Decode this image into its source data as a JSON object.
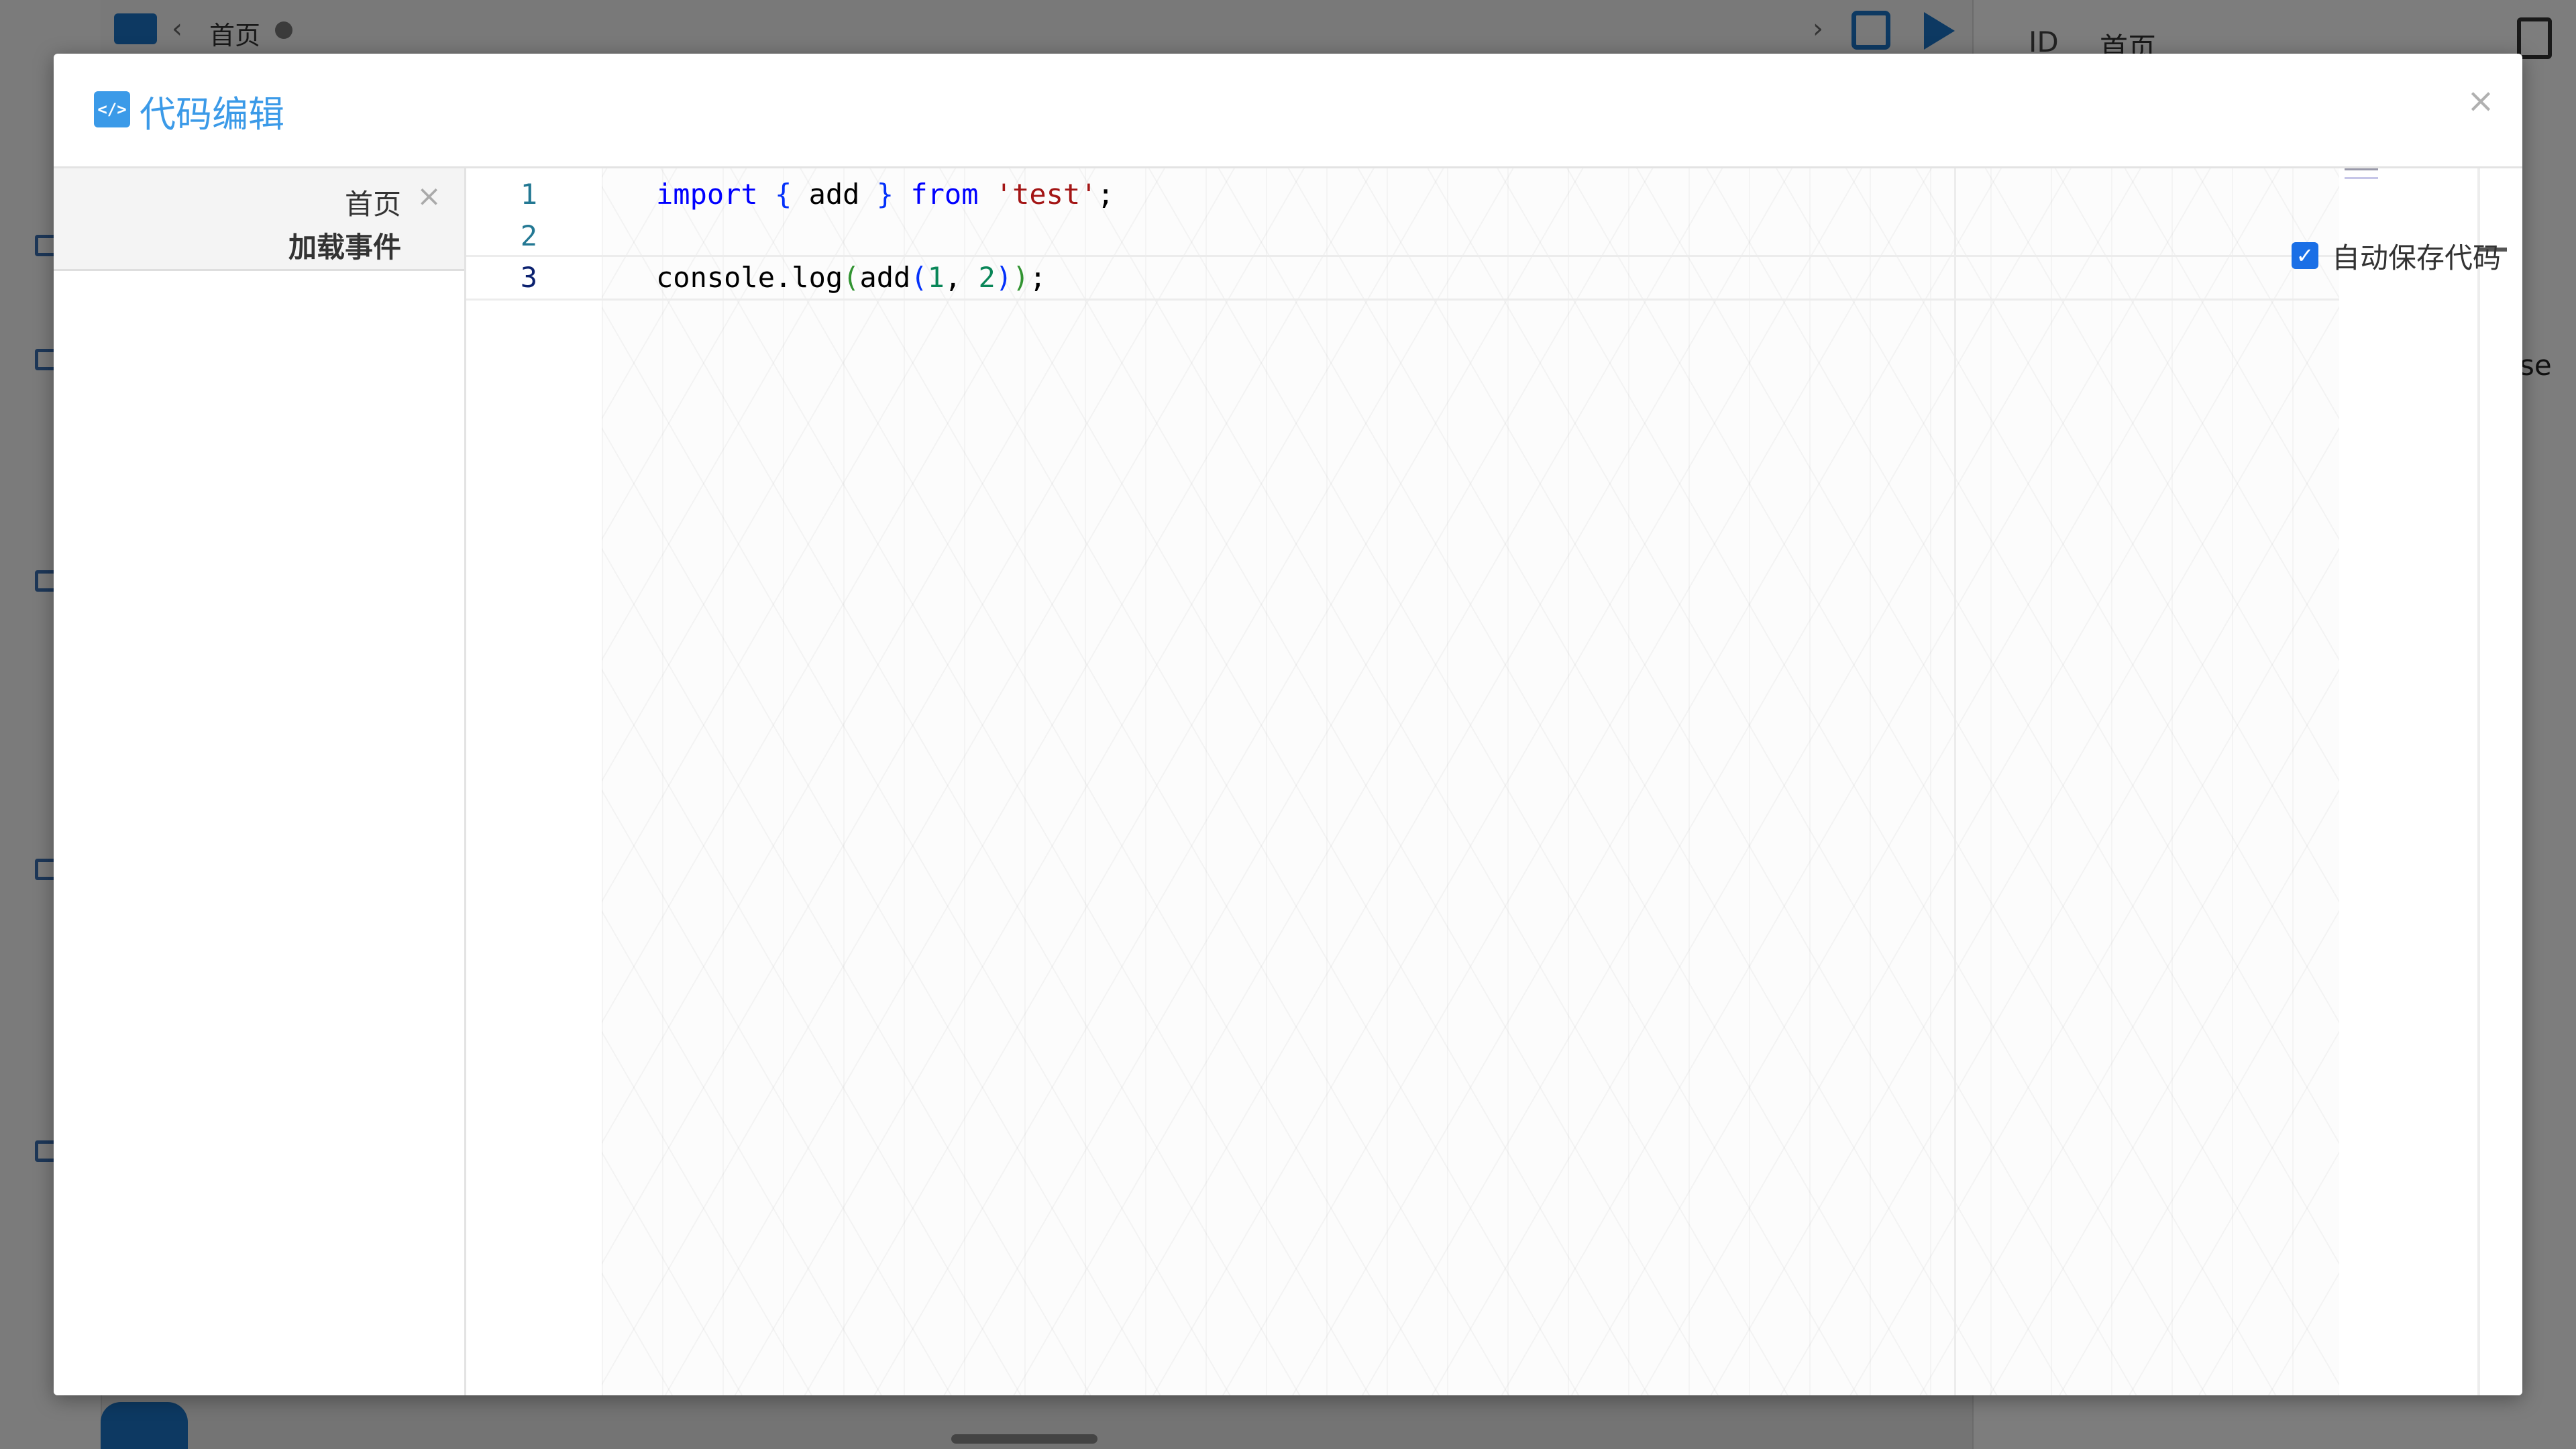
{
  "background": {
    "tab_label": "首页",
    "right_panel": {
      "id_label": "ID",
      "page_label": "首页",
      "partial_text": "se"
    },
    "icons": [
      "folder-icon",
      "chevron-left-icon",
      "chevron-right-icon",
      "save-icon",
      "play-icon",
      "page-icon",
      "layers-icon"
    ]
  },
  "modal": {
    "title_icon_glyph": "</>",
    "title": "代码编辑",
    "close_glyph": "×",
    "sidebar": {
      "group_label": "首页",
      "close_glyph": "×",
      "event_label": "加载事件"
    },
    "editor": {
      "line_numbers": [
        "1",
        "2",
        "3"
      ],
      "lines": [
        "import { add } from 'test';",
        "",
        "console.log(add(1, 2));"
      ],
      "current_line": 3
    },
    "autosave": {
      "checked": true,
      "label": "自动保存代码"
    }
  },
  "colors": {
    "accent": "#3b9ae8",
    "checkbox": "#1a6fe6",
    "keyword": "#0000ff",
    "string": "#a31515",
    "number": "#098658",
    "line_number": "#237893"
  }
}
